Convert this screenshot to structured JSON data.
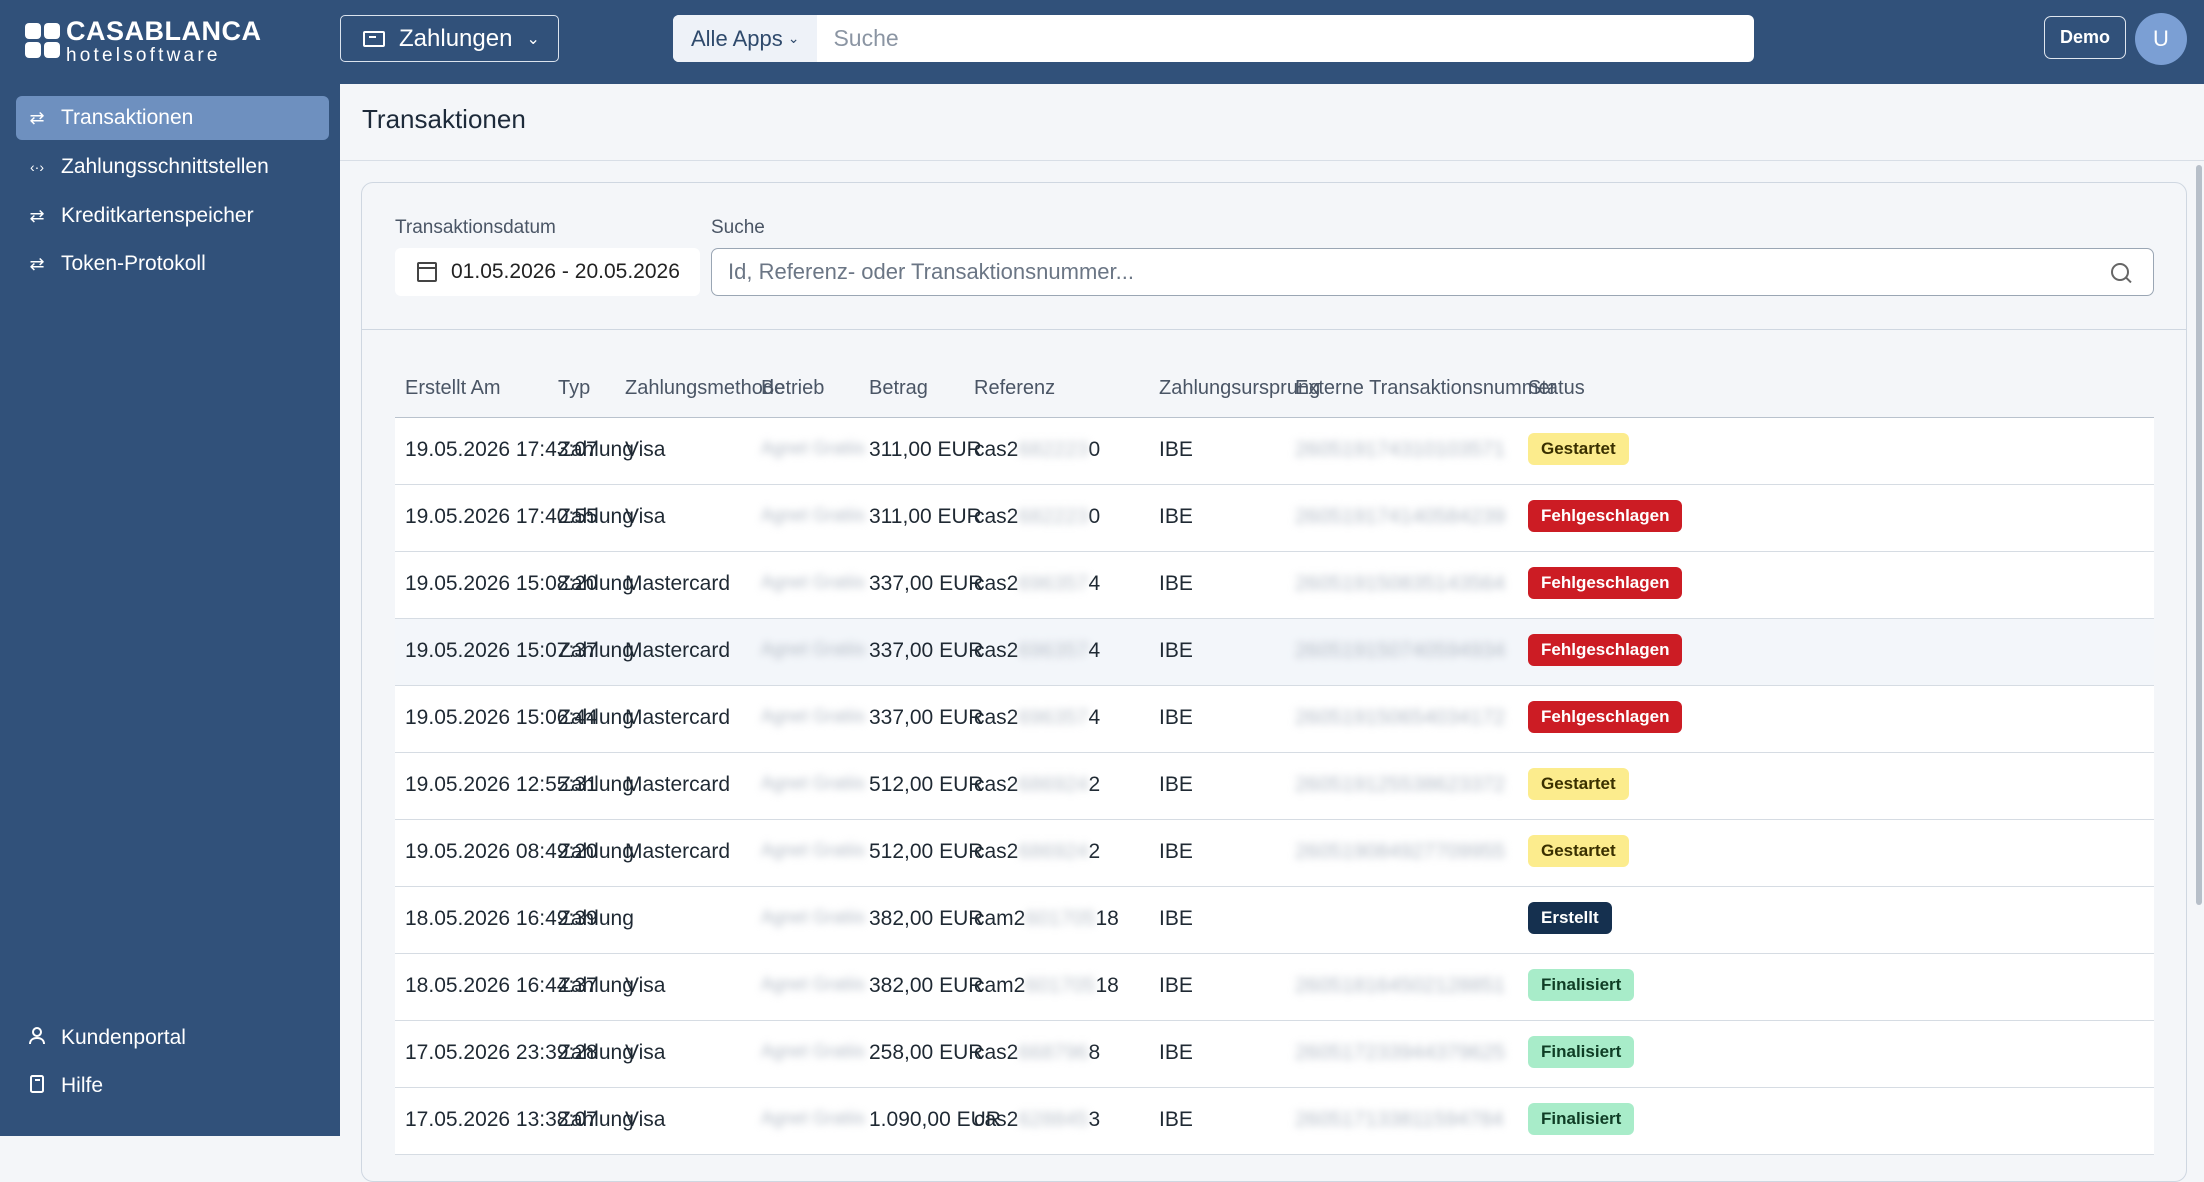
{
  "brand": {
    "title": "CASABLANCA",
    "subtitle": "hotelsoftware"
  },
  "topbar": {
    "app_selector": "Zahlungen",
    "search_scope": "Alle Apps",
    "search_placeholder": "Suche",
    "demo_label": "Demo",
    "avatar_initial": "U"
  },
  "sidebar": {
    "items": [
      {
        "label": "Transaktionen",
        "icon": "⇄"
      },
      {
        "label": "Zahlungsschnittstellen",
        "icon": "‹·›"
      },
      {
        "label": "Kreditkartenspeicher",
        "icon": "⇄"
      },
      {
        "label": "Token-Protokoll",
        "icon": "⇄"
      }
    ],
    "footer": [
      {
        "label": "Kundenportal",
        "icon": "person-icon"
      },
      {
        "label": "Hilfe",
        "icon": "book-icon"
      }
    ]
  },
  "page": {
    "title": "Transaktionen"
  },
  "filters": {
    "date_label": "Transaktionsdatum",
    "date_value": "01.05.2026 - 20.05.2026",
    "search_label": "Suche",
    "search_placeholder": "Id, Referenz- oder Transaktionsnummer..."
  },
  "table": {
    "headers": [
      "Erstellt Am",
      "Typ",
      "Zahlungsmethode",
      "Betrieb",
      "Betrag",
      "Referenz",
      "Zahlungsursprung",
      "Externe Transaktionsnummer",
      "Status"
    ],
    "rows": [
      {
        "date": "19.05.2026 17:43:07",
        "type": "Zahlung",
        "method": "Visa",
        "betrieb": "Agnet Gratiis",
        "amount": "311,00 EUR",
        "ref_pre": "cas2",
        "ref_mid": "682223",
        "ref_post": "0",
        "origin": "IBE",
        "ext": "260519174310103571",
        "status": "Gestartet",
        "status_kind": "started"
      },
      {
        "date": "19.05.2026 17:40:55",
        "type": "Zahlung",
        "method": "Visa",
        "betrieb": "Agnet Gratiis",
        "amount": "311,00 EUR",
        "ref_pre": "cas2",
        "ref_mid": "682223",
        "ref_post": "0",
        "origin": "IBE",
        "ext": "260519174140584239",
        "status": "Fehlgeschlagen",
        "status_kind": "failed"
      },
      {
        "date": "19.05.2026 15:08:20",
        "type": "Zahlung",
        "method": "Mastercard",
        "betrieb": "Agnet Gratiis",
        "amount": "337,00 EUR",
        "ref_pre": "cas2",
        "ref_mid": "696357",
        "ref_post": "4",
        "origin": "IBE",
        "ext": "260519150835143564",
        "status": "Fehlgeschlagen",
        "status_kind": "failed"
      },
      {
        "date": "19.05.2026 15:07:37",
        "type": "Zahlung",
        "method": "Mastercard",
        "betrieb": "Agnet Gratiis",
        "amount": "337,00 EUR",
        "ref_pre": "cas2",
        "ref_mid": "696357",
        "ref_post": "4",
        "origin": "IBE",
        "ext": "260519150740594934",
        "status": "Fehlgeschlagen",
        "status_kind": "failed"
      },
      {
        "date": "19.05.2026 15:06:44",
        "type": "Zahlung",
        "method": "Mastercard",
        "betrieb": "Agnet Gratiis",
        "amount": "337,00 EUR",
        "ref_pre": "cas2",
        "ref_mid": "696357",
        "ref_post": "4",
        "origin": "IBE",
        "ext": "260519150654034172",
        "status": "Fehlgeschlagen",
        "status_kind": "failed"
      },
      {
        "date": "19.05.2026 12:55:31",
        "type": "Zahlung",
        "method": "Mastercard",
        "betrieb": "Agnet Gratiis",
        "amount": "512,00 EUR",
        "ref_pre": "cas2",
        "ref_mid": "686924",
        "ref_post": "2",
        "origin": "IBE",
        "ext": "260519125538623372",
        "status": "Gestartet",
        "status_kind": "started"
      },
      {
        "date": "19.05.2026 08:49:20",
        "type": "Zahlung",
        "method": "Mastercard",
        "betrieb": "Agnet Gratiis",
        "amount": "512,00 EUR",
        "ref_pre": "cas2",
        "ref_mid": "686924",
        "ref_post": "2",
        "origin": "IBE",
        "ext": "260519084927709955",
        "status": "Gestartet",
        "status_kind": "started"
      },
      {
        "date": "18.05.2026 16:49:39",
        "type": "Zahlung",
        "method": "",
        "betrieb": "Agnet Gratiis",
        "amount": "382,00 EUR",
        "ref_pre": "cam2",
        "ref_mid": "601705",
        "ref_post": "18",
        "origin": "IBE",
        "ext": "",
        "status": "Erstellt",
        "status_kind": "created"
      },
      {
        "date": "18.05.2026 16:44:37",
        "type": "Zahlung",
        "method": "Visa",
        "betrieb": "Agnet Gratiis",
        "amount": "382,00 EUR",
        "ref_pre": "cam2",
        "ref_mid": "601705",
        "ref_post": "18",
        "origin": "IBE",
        "ext": "260518164502128851",
        "status": "Finalisiert",
        "status_kind": "final"
      },
      {
        "date": "17.05.2026 23:39:28",
        "type": "Zahlung",
        "method": "Visa",
        "betrieb": "Agnet Gratiis",
        "amount": "258,00 EUR",
        "ref_pre": "cas2",
        "ref_mid": "668796",
        "ref_post": "8",
        "origin": "IBE",
        "ext": "260517233944379625",
        "status": "Finalisiert",
        "status_kind": "final"
      },
      {
        "date": "17.05.2026 13:38:07",
        "type": "Zahlung",
        "method": "Visa",
        "betrieb": "Agnet Gratiis",
        "amount": "1.090,00 EUR",
        "ref_pre": "cas2",
        "ref_mid": "628845",
        "ref_post": "3",
        "origin": "IBE",
        "ext": "260517133811594784",
        "status": "Finalisiert",
        "status_kind": "final"
      }
    ]
  },
  "colors": {
    "sidebar": "#31517a",
    "active": "#6e90bf",
    "failed": "#cc1c24",
    "started": "#fcec8d",
    "final": "#a8ecc9",
    "created": "#15304f"
  }
}
